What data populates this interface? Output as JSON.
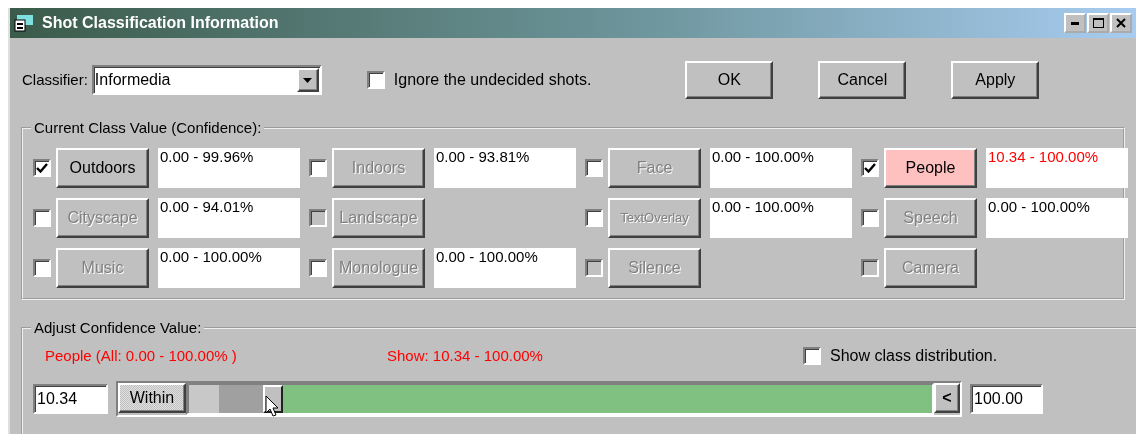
{
  "window": {
    "title": "Shot Classification Information"
  },
  "classifier": {
    "label": "Classifier:",
    "value": "Informedia"
  },
  "ignore_undecided": {
    "label": "Ignore the undecided shots.",
    "checked": false
  },
  "buttons": [
    "OK",
    "Cancel",
    "Apply"
  ],
  "class_group": {
    "title": "Current Class Value (Confidence):",
    "classes": [
      {
        "name": "Outdoors",
        "checked": true,
        "checkbox_disabled": false,
        "label_disabled": false,
        "active": false,
        "value": "0.00 - 99.96%"
      },
      {
        "name": "Indoors",
        "checked": false,
        "checkbox_disabled": false,
        "label_disabled": true,
        "active": false,
        "value": "0.00 - 93.81%"
      },
      {
        "name": "Face",
        "checked": false,
        "checkbox_disabled": false,
        "label_disabled": true,
        "active": false,
        "value": "0.00 - 100.00%"
      },
      {
        "name": "People",
        "checked": true,
        "checkbox_disabled": false,
        "label_disabled": false,
        "active": true,
        "value": "10.34 - 100.00%"
      },
      {
        "name": "Cityscape",
        "checked": false,
        "checkbox_disabled": false,
        "label_disabled": true,
        "active": false,
        "value": "0.00 - 94.01%"
      },
      {
        "name": "Landscape",
        "checked": false,
        "checkbox_disabled": true,
        "label_disabled": true,
        "active": false
      },
      {
        "name": "TextOverlay",
        "checked": false,
        "checkbox_disabled": false,
        "label_disabled": true,
        "active": false,
        "value": "0.00 - 100.00%"
      },
      {
        "name": "Speech",
        "checked": false,
        "checkbox_disabled": false,
        "label_disabled": true,
        "active": false,
        "value": "0.00 - 100.00%"
      },
      {
        "name": "Music",
        "checked": false,
        "checkbox_disabled": false,
        "label_disabled": true,
        "active": false,
        "value": "0.00 - 100.00%"
      },
      {
        "name": "Monologue",
        "checked": false,
        "checkbox_disabled": false,
        "label_disabled": true,
        "active": false,
        "value": "0.00 - 100.00%"
      },
      {
        "name": "Silence",
        "checked": false,
        "checkbox_disabled": true,
        "label_disabled": true,
        "active": false
      },
      {
        "name": "Camera",
        "checked": false,
        "checkbox_disabled": true,
        "label_disabled": true,
        "active": false
      }
    ]
  },
  "adjust": {
    "title": "Adjust Confidence Value:",
    "class_range": "People (All: 0.00 - 100.00% )",
    "show_range": "Show: 10.34 - 100.00%",
    "show_distribution": {
      "label": "Show class distribution.",
      "checked": false
    },
    "low": "10.34",
    "mode": "Within",
    "slider": {
      "level": 0.1034
    },
    "scroll_button": "<",
    "high": "100.00"
  }
}
